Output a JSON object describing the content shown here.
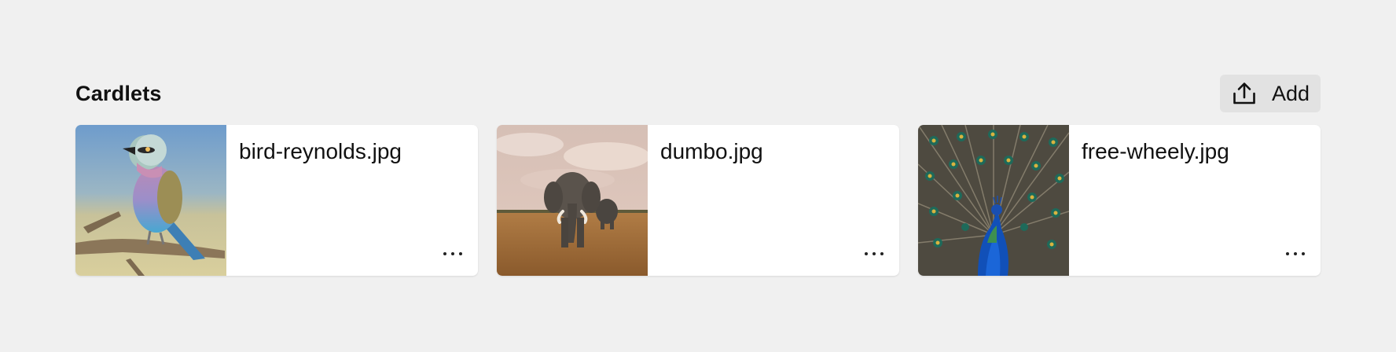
{
  "section": {
    "title": "Cardlets",
    "add_label": "Add",
    "add_icon": "upload-icon"
  },
  "cards": [
    {
      "file_name": "bird-reynolds.jpg",
      "image": "lilac-breasted-roller-bird-photo",
      "menu_icon": "more-horizontal-icon"
    },
    {
      "file_name": "dumbo.jpg",
      "image": "elephants-in-savanna-photo",
      "menu_icon": "more-horizontal-icon"
    },
    {
      "file_name": "free-wheely.jpg",
      "image": "peacock-feathers-photo",
      "menu_icon": "more-horizontal-icon"
    }
  ],
  "colors": {
    "background": "#f0f0f0",
    "card": "#ffffff",
    "add_button_bg": "#e2e2e2",
    "text": "#111111"
  }
}
